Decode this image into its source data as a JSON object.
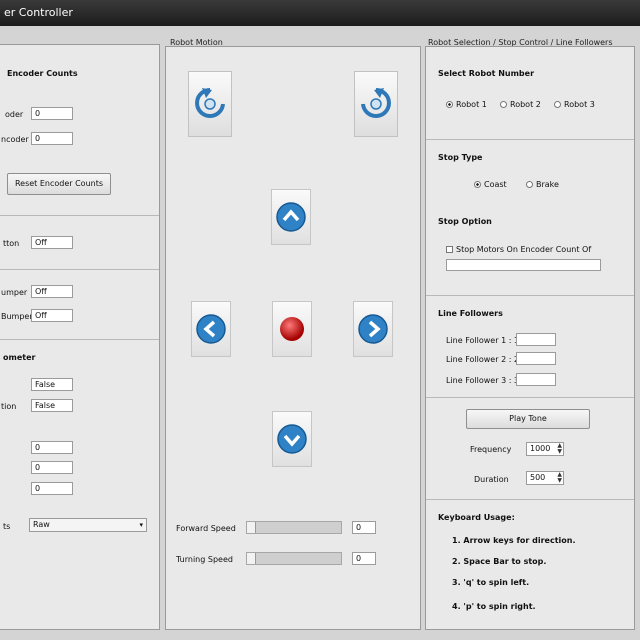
{
  "window": {
    "title": "er Controller"
  },
  "left": {
    "encoder_title": "Encoder Counts",
    "enc_label1": "oder",
    "enc_value1": "0",
    "enc_label2": "ncoder",
    "enc_value2": "0",
    "reset_button": "Reset Encoder Counts",
    "status1_label": "tton",
    "status1_value": "Off",
    "status2_label": "umper",
    "status2_value": "Off",
    "status3_label": "Bumper",
    "status3_value": "Off",
    "section_title": "ometer",
    "r1_label": "",
    "r1_value": "False",
    "r2_label": "tion",
    "r2_value": "False",
    "n1_value": "0",
    "n2_value": "0",
    "n3_value": "0",
    "dd_label": "ts",
    "dd_value": "Raw"
  },
  "motion": {
    "title": "Robot Motion",
    "forward_label": "Forward Speed",
    "forward_value": "0",
    "forward_level": 0,
    "turning_label": "Turning Speed",
    "turning_value": "0",
    "turning_level": 0
  },
  "right": {
    "title": "Robot Selection / Stop Control / Line Followers",
    "select_title": "Select Robot Number",
    "robots": [
      "Robot 1",
      "Robot 2",
      "Robot 3"
    ],
    "stop_type_title": "Stop Type",
    "stop_coast": "Coast",
    "stop_brake": "Brake",
    "stop_option_title": "Stop Option",
    "stop_option_check": "Stop Motors On Encoder Count Of",
    "line_title": "Line Followers",
    "line_labels": [
      "Line Follower 1 : 1",
      "Line Follower 2 : 2",
      "Line Follower 3 : 3"
    ],
    "play_button": "Play Tone",
    "freq_label": "Frequency",
    "freq_value": "1000",
    "dur_label": "Duration",
    "dur_value": "500",
    "kb_title": "Keyboard Usage:",
    "kb_items": [
      "1. Arrow keys for direction.",
      "2. Space Bar to stop.",
      "3. 'q' to spin left.",
      "4. 'p' to spin right."
    ]
  }
}
